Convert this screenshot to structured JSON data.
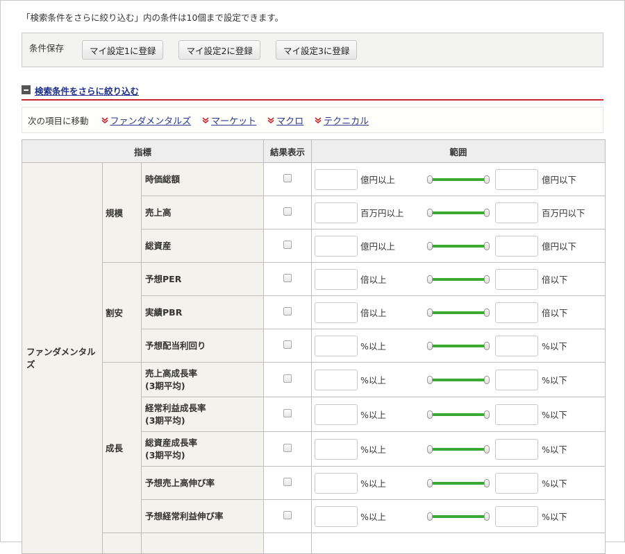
{
  "notice": "「検索条件をさらに絞り込む」内の条件は10個まで設定できます。",
  "save": {
    "label": "条件保存",
    "buttons": [
      "マイ設定1に登録",
      "マイ設定2に登録",
      "マイ設定3に登録"
    ]
  },
  "section": {
    "title": "検索条件をさらに絞り込む"
  },
  "nav": {
    "label": "次の項目に移動",
    "links": [
      "ファンダメンタルズ",
      "マーケット",
      "マクロ",
      "テクニカル"
    ]
  },
  "table": {
    "headers": {
      "indicator": "指標",
      "result": "結果表示",
      "range": "範囲"
    },
    "category": "ファンダメンタルズ",
    "groups": [
      {
        "name": "規模",
        "rows": [
          {
            "name": "時価総額",
            "min_unit": "億円以上",
            "max_unit": "億円以下"
          },
          {
            "name": "売上高",
            "min_unit": "百万円以上",
            "max_unit": "百万円以下"
          },
          {
            "name": "総資産",
            "min_unit": "億円以上",
            "max_unit": "億円以下"
          }
        ]
      },
      {
        "name": "割安",
        "rows": [
          {
            "name": "予想PER",
            "min_unit": "倍以上",
            "max_unit": "倍以下"
          },
          {
            "name": "実績PBR",
            "min_unit": "倍以上",
            "max_unit": "倍以下"
          },
          {
            "name": "予想配当利回り",
            "min_unit": "%以上",
            "max_unit": "%以下"
          }
        ]
      },
      {
        "name": "成長",
        "rows": [
          {
            "name": "売上高成長率",
            "name2": "(3期平均)",
            "min_unit": "%以上",
            "max_unit": "%以下"
          },
          {
            "name": "経常利益成長率",
            "name2": "(3期平均)",
            "min_unit": "%以上",
            "max_unit": "%以下"
          },
          {
            "name": "総資産成長率",
            "name2": "(3期平均)",
            "min_unit": "%以上",
            "max_unit": "%以下"
          },
          {
            "name": "予想売上高伸び率",
            "min_unit": "%以上",
            "max_unit": "%以下"
          },
          {
            "name": "予想経常利益伸び率",
            "min_unit": "%以上",
            "max_unit": "%以下"
          }
        ]
      }
    ]
  },
  "colors": {
    "accent_red": "#c9222c",
    "link": "#2b3a8e",
    "slider": "#3aaa35"
  }
}
